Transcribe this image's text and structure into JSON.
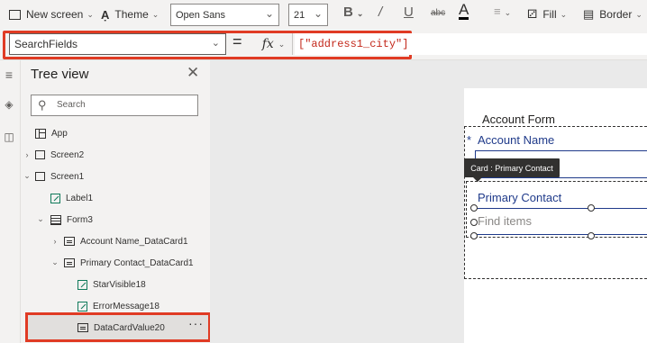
{
  "ribbon": {
    "new_screen": "New screen",
    "theme": "Theme",
    "font": "Open Sans",
    "font_size": "21",
    "bold": "B",
    "italic": "/",
    "underline": "U",
    "strikethrough": "abc",
    "font_color": "A",
    "fill": "Fill",
    "border": "Border"
  },
  "formula_bar": {
    "property": "SearchFields",
    "equals": "=",
    "fx": "fx",
    "formula": "[\"address1_city\"]"
  },
  "tree_view": {
    "title": "Tree view",
    "search_placeholder": "Search",
    "nodes": [
      {
        "label": "App",
        "icon": "app-icon"
      },
      {
        "label": "Screen2",
        "icon": "screen-icon",
        "chevron": "right"
      },
      {
        "label": "Screen1",
        "icon": "screen-icon",
        "chevron": "down"
      },
      {
        "label": "Label1",
        "icon": "label-icon"
      },
      {
        "label": "Form3",
        "icon": "form-icon",
        "chevron": "down"
      },
      {
        "label": "Account Name_DataCard1",
        "icon": "card-icon",
        "chevron": "right"
      },
      {
        "label": "Primary Contact_DataCard1",
        "icon": "card-icon",
        "chevron": "down"
      },
      {
        "label": "StarVisible18",
        "icon": "label-icon"
      },
      {
        "label": "ErrorMessage18",
        "icon": "label-icon"
      },
      {
        "label": "DataCardValue20",
        "icon": "card-icon",
        "selected": true
      }
    ],
    "more": "···"
  },
  "canvas": {
    "form_title": "Account Form",
    "required_marker": "*",
    "account_name_label": "Account Name",
    "tooltip": "Card : Primary Contact",
    "primary_contact_label": "Primary Contact",
    "find_placeholder": "Find items"
  },
  "colors": {
    "highlight": "#e03b24",
    "form_text": "#1f3a8a",
    "formula_string": "#c3271a"
  }
}
